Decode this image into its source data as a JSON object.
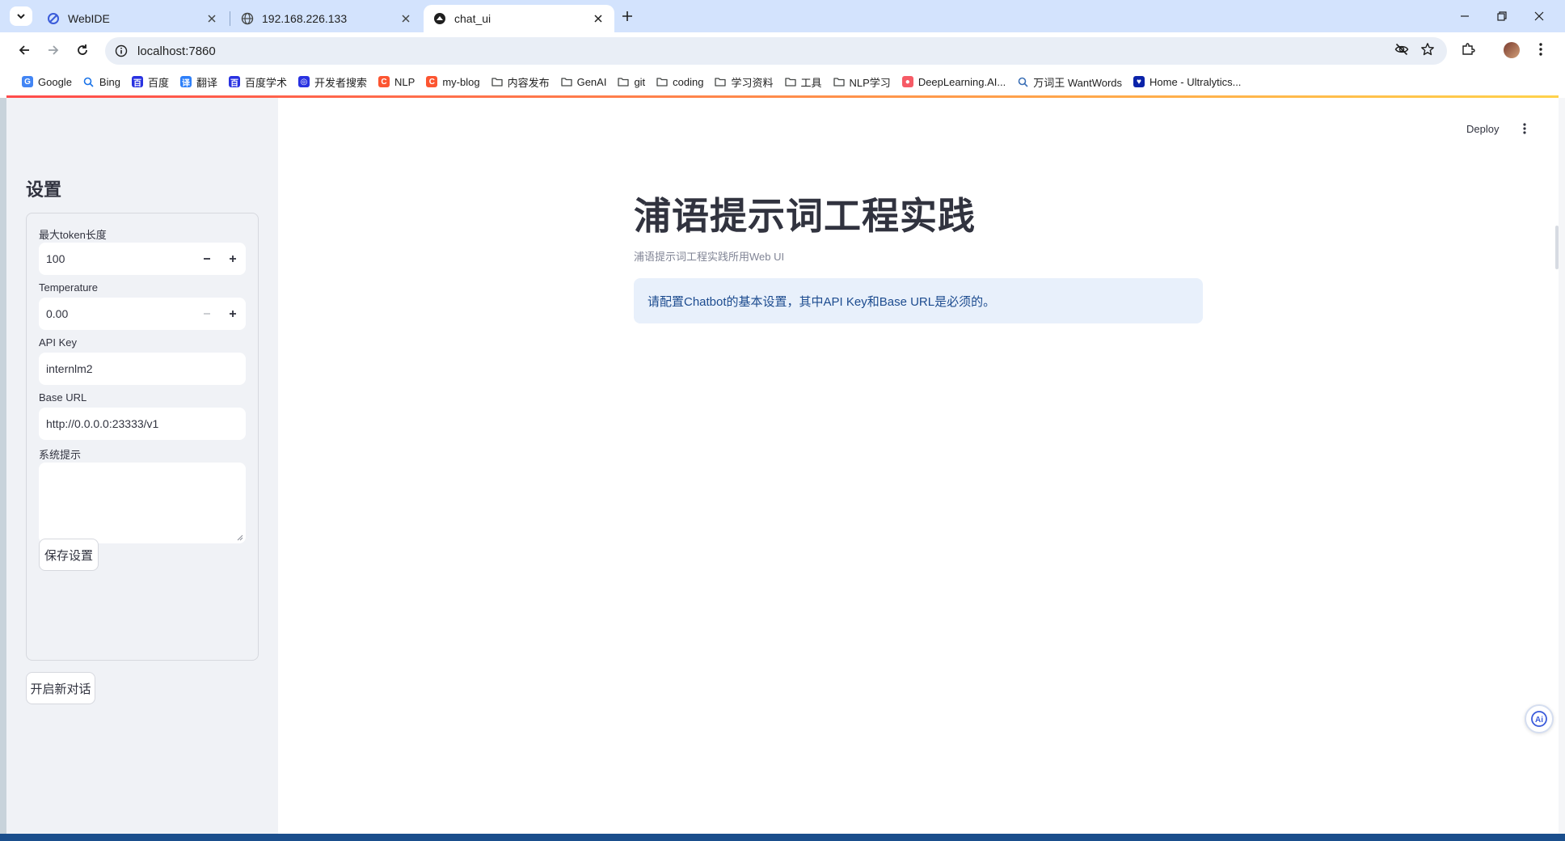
{
  "browser": {
    "tabs": [
      {
        "title": "WebIDE",
        "icon": "webide-icon"
      },
      {
        "title": "192.168.226.133",
        "icon": "globe-icon"
      },
      {
        "title": "chat_ui",
        "icon": "streamlit-icon"
      }
    ],
    "url": "localhost:7860",
    "bookmarks": [
      {
        "label": "Google",
        "icon": "google-icon",
        "color": "#4285f4"
      },
      {
        "label": "Bing",
        "icon": "search-icon",
        "color": "#1a73e8"
      },
      {
        "label": "百度",
        "icon": "baidu-icon",
        "color": "#2932e1"
      },
      {
        "label": "翻译",
        "icon": "translate-icon",
        "color": "#2d7ff9"
      },
      {
        "label": "百度学术",
        "icon": "baidu-icon",
        "color": "#2932e1"
      },
      {
        "label": "开发者搜索",
        "icon": "dev-search-icon",
        "color": "#2932e1"
      },
      {
        "label": "NLP",
        "icon": "csdn-icon",
        "color": "#fc5531"
      },
      {
        "label": "my-blog",
        "icon": "csdn-icon",
        "color": "#fc5531"
      },
      {
        "label": "内容发布",
        "icon": "folder-icon",
        "color": "#444746"
      },
      {
        "label": "GenAI",
        "icon": "folder-icon",
        "color": "#444746"
      },
      {
        "label": "git",
        "icon": "folder-icon",
        "color": "#444746"
      },
      {
        "label": "coding",
        "icon": "folder-icon",
        "color": "#444746"
      },
      {
        "label": "学习资料",
        "icon": "folder-icon",
        "color": "#444746"
      },
      {
        "label": "工具",
        "icon": "folder-icon",
        "color": "#444746"
      },
      {
        "label": "NLP学习",
        "icon": "folder-icon",
        "color": "#444746"
      },
      {
        "label": "DeepLearning.AI...",
        "icon": "deeplearning-icon",
        "color": "#f65b66"
      },
      {
        "label": "万词王 WantWords",
        "icon": "magnifier-icon",
        "color": "#3b6fb6"
      },
      {
        "label": "Home - Ultralytics...",
        "icon": "ultralytics-icon",
        "color": "#0b23a9"
      }
    ]
  },
  "sidebar": {
    "title": "设置",
    "max_tokens": {
      "label": "最大token长度",
      "value": "100"
    },
    "temperature": {
      "label": "Temperature",
      "value": "0.00"
    },
    "api_key": {
      "label": "API Key",
      "value": "internlm2"
    },
    "base_url": {
      "label": "Base URL",
      "value": "http://0.0.0.0:23333/v1"
    },
    "system_prompt": {
      "label": "系统提示",
      "value": ""
    },
    "save_button": "保存设置",
    "new_chat_button": "开启新对话"
  },
  "main": {
    "deploy_label": "Deploy",
    "title": "浦语提示词工程实践",
    "caption": "浦语提示词工程实践所用Web UI",
    "info": "请配置Chatbot的基本设置，其中API Key和Base URL是必须的。"
  },
  "colors": {
    "accent": "#ff4b4b",
    "info_bg": "#e8f0fb",
    "info_text": "#1c4b8f",
    "sidebar_bg": "#f0f2f6",
    "chrome_bg": "#d3e3fd"
  }
}
